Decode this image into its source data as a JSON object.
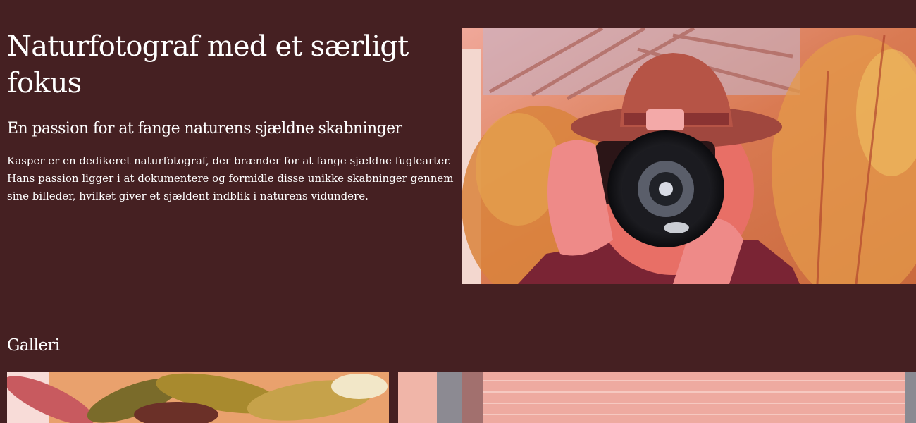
{
  "hero": {
    "title": "Naturfotograf med et særligt fokus",
    "subtitle": "En passion for at fange naturens sjældne skabninger",
    "body": "Kasper er en dedikeret naturfotograf, der brænder for at fange sjældne fuglearter. Hans passion ligger i at dokumentere og formidle disse unikke skabninger gennem sine billeder, hvilket giver et sjældent indblik i naturens vidundere.",
    "image_icon": "photographer-with-camera-photo"
  },
  "gallery": {
    "title": "Galleri",
    "images": [
      "plant-leaves-photo",
      "greenhouse-photo"
    ]
  },
  "colors": {
    "background": "#452022",
    "text": "#ffffff"
  }
}
